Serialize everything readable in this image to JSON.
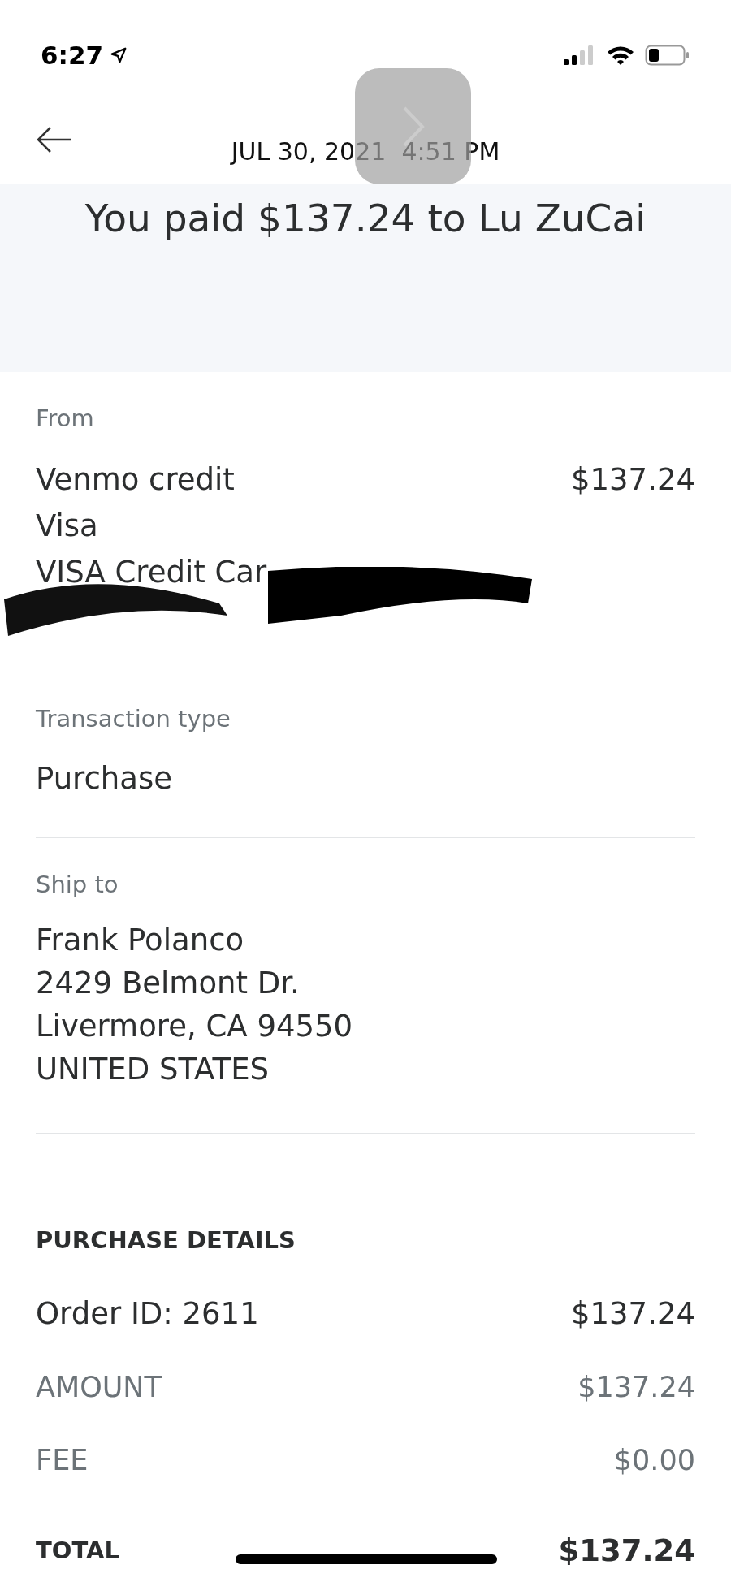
{
  "status_bar": {
    "time": "6:27"
  },
  "header": {
    "date": "JUL 30, 2021  4:51 PM"
  },
  "banner": {
    "title": "You paid $137.24 to Lu ZuCai"
  },
  "from": {
    "label": "From",
    "lines": [
      "Venmo credit",
      "Visa",
      "VISA Credit Car"
    ],
    "amount": "$137.24"
  },
  "transaction_type": {
    "label": "Transaction type",
    "value": "Purchase"
  },
  "ship_to": {
    "label": "Ship to",
    "lines": [
      "Frank Polanco",
      "2429 Belmont Dr.",
      "Livermore, CA 94550",
      "UNITED STATES"
    ]
  },
  "purchase_details": {
    "heading": "PURCHASE DETAILS",
    "rows": [
      {
        "kind": "item",
        "label": "Order ID: 2611",
        "amount": "$137.24"
      },
      {
        "kind": "muted",
        "label": "AMOUNT",
        "amount": "$137.24"
      },
      {
        "kind": "muted",
        "label": "FEE",
        "amount": "$0.00"
      },
      {
        "kind": "total",
        "label": "TOTAL",
        "amount": "$137.24"
      }
    ]
  }
}
